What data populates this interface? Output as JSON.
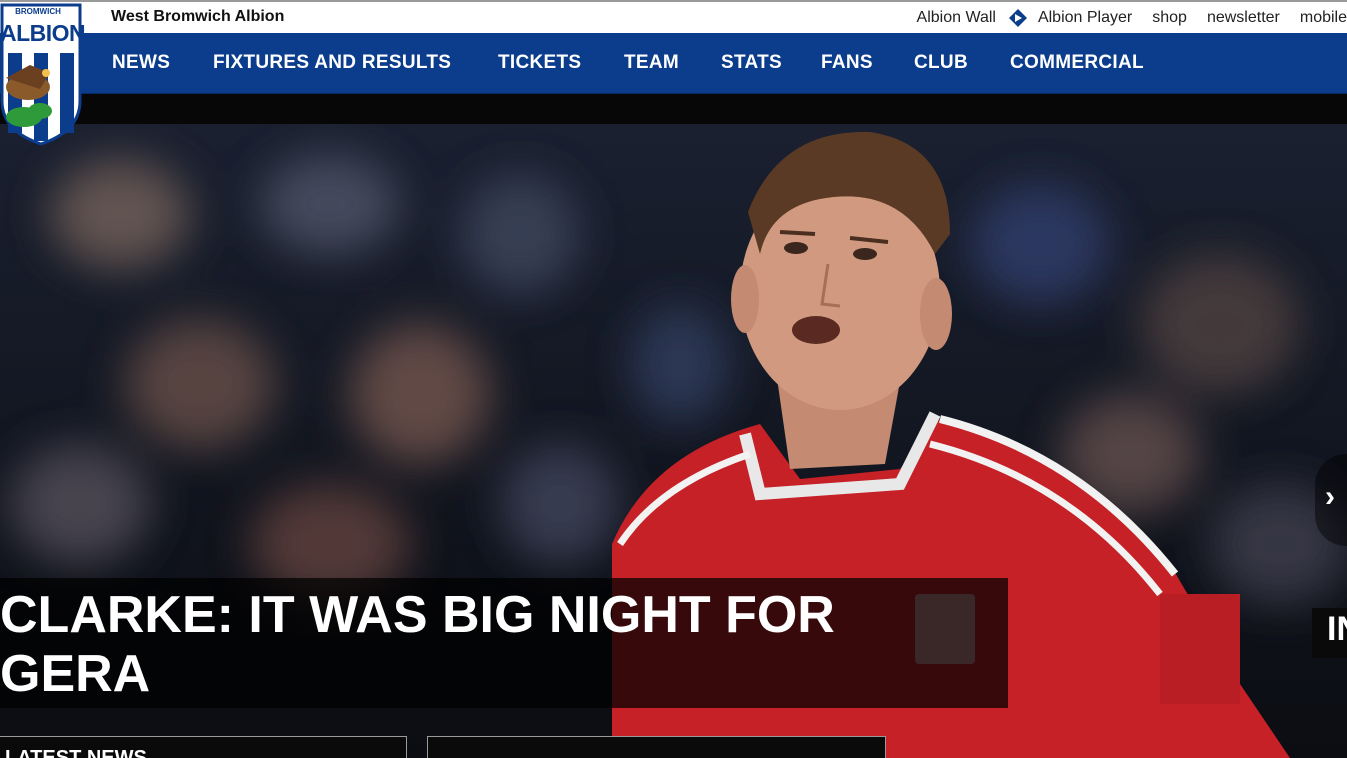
{
  "header": {
    "site_name": "West Bromwich Albion",
    "crest": {
      "text_top": "BROMWICH",
      "text_main": "ALBION"
    },
    "utility_links": [
      {
        "label": "Albion Wall"
      },
      {
        "label": "Albion Player"
      },
      {
        "label": "shop"
      },
      {
        "label": "newsletter"
      },
      {
        "label": "mobile"
      }
    ]
  },
  "nav": {
    "items": [
      {
        "label": "NEWS"
      },
      {
        "label": "FIXTURES AND RESULTS"
      },
      {
        "label": "TICKETS"
      },
      {
        "label": "TEAM"
      },
      {
        "label": "STATS"
      },
      {
        "label": "FANS"
      },
      {
        "label": "CLUB"
      },
      {
        "label": "COMMERCIAL"
      }
    ]
  },
  "hero": {
    "headline_line1": "CLARKE: IT WAS BIG NIGHT FOR",
    "headline_line2": "GERA",
    "next_arrow": "›",
    "side_tag": "IN"
  },
  "panels": {
    "left_title": "LATEST NEWS",
    "mid_title": ""
  },
  "colors": {
    "nav_blue": "#0b3d8c",
    "kit_red": "#d0252a",
    "top_bar": "#ffffff"
  }
}
